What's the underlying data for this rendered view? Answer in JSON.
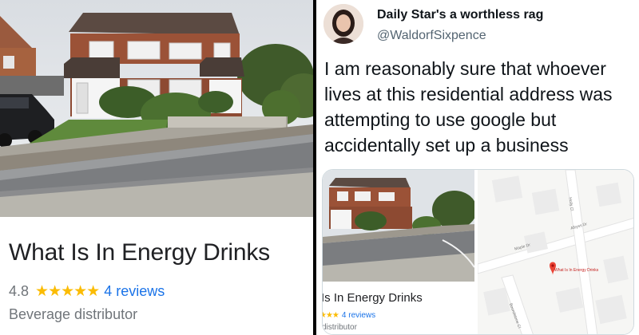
{
  "listing": {
    "name": "What Is In Energy Drinks",
    "rating": "4.8",
    "stars": "★★★★★",
    "rating_value": 4.8,
    "reviews": "4 reviews",
    "category": "Beverage distributor",
    "colors": {
      "star": "#fbbc04",
      "link": "#1a73e8",
      "muted": "#70757a"
    }
  },
  "tweet": {
    "display_name": "Daily Star's a worthless rag",
    "handle": "@WaldorfSixpence",
    "text": "I am reasonably sure that whoever lives at this residential address was attempting to use google but accidentally set up a business",
    "media": {
      "name": "Is In Energy Drinks",
      "stars": "★★★",
      "reviews": "4 reviews",
      "category": "distributor",
      "map": {
        "pin_label": "What Is In Energy Drinks",
        "street_1": "Maple Dr",
        "street_2": "Albyss Dr",
        "street_3": "Holly Cl",
        "street_4": "Boundstone Cl"
      }
    }
  }
}
